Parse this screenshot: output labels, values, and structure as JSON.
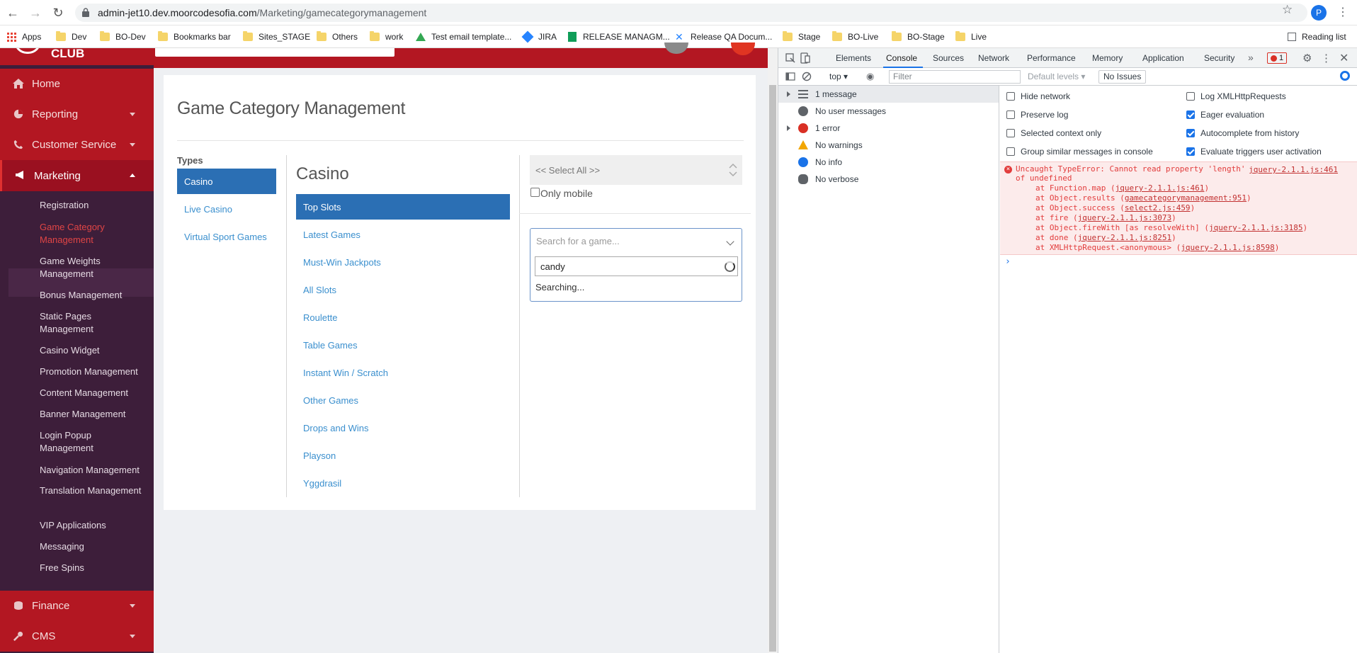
{
  "browser": {
    "url_host": "admin-jet10.dev.moorcodesofia.com",
    "url_path": "/Marketing/gamecategorymanagement",
    "profile_initial": "P",
    "bookmarks": [
      "Apps",
      "Dev",
      "BO-Dev",
      "Bookmarks bar",
      "Sites_STAGE",
      "Others",
      "work",
      "Test email template...",
      "JIRA",
      "RELEASE MANAGM...",
      "Release QA Docum...",
      "Stage",
      "BO-Live",
      "BO-Stage",
      "Live"
    ],
    "reading_list": "Reading list"
  },
  "header": {
    "logo_text": "CLUB"
  },
  "sidebar": {
    "main_items": [
      "Home",
      "Reporting",
      "Customer Service",
      "Marketing",
      "Finance",
      "CMS"
    ],
    "sub_items": [
      "Registration",
      "Game Category Management",
      "Game Weights Management",
      "Bonus Management",
      "Static Pages Management",
      "Casino Widget",
      "Promotion Management",
      "Content Management",
      "Banner Management",
      "Login Popup Management",
      "Navigation Management",
      "Translation Management",
      "VIP Applications",
      "Messaging",
      "Free Spins"
    ]
  },
  "page": {
    "title": "Game Category Management",
    "types_label": "Types",
    "types": [
      "Casino",
      "Live Casino",
      "Virtual Sport Games"
    ],
    "category_heading": "Casino",
    "categories": [
      "Top Slots",
      "Latest Games",
      "Must-Win Jackpots",
      "All Slots",
      "Roulette",
      "Table Games",
      "Instant Win / Scratch",
      "Other Games",
      "Drops and Wins",
      "Playson",
      "Yggdrasil"
    ],
    "select_all": "<< Select All >>",
    "only_mobile": "Only mobile",
    "search_placeholder": "Search for a game...",
    "search_query": "candy",
    "search_status": "Searching..."
  },
  "devtools": {
    "tabs": [
      "Elements",
      "Console",
      "Sources",
      "Network",
      "Performance",
      "Memory",
      "Application",
      "Security"
    ],
    "error_count": "1",
    "context": "top",
    "filter_placeholder": "Filter",
    "levels": "Default levels",
    "issues": "No Issues",
    "sidebar_items": [
      "1 message",
      "No user messages",
      "1 error",
      "No warnings",
      "No info",
      "No verbose"
    ],
    "options_left": [
      "Hide network",
      "Preserve log",
      "Selected context only",
      "Group similar messages in console"
    ],
    "options_right": [
      "Log XMLHttpRequests",
      "Eager evaluation",
      "Autocomplete from history",
      "Evaluate triggers user activation"
    ],
    "error": {
      "line1": "Uncaught TypeError: Cannot read property 'length'",
      "line2": "of undefined",
      "source": "jquery-2.1.1.js:461",
      "stack": [
        {
          "pre": "at Function.map (",
          "link": "jquery-2.1.1.js:461",
          "post": ")"
        },
        {
          "pre": "at Object.results (",
          "link": "gamecategorymanagement:951",
          "post": ")"
        },
        {
          "pre": "at Object.success (",
          "link": "select2.js:459",
          "post": ")"
        },
        {
          "pre": "at fire (",
          "link": "jquery-2.1.1.js:3073",
          "post": ")"
        },
        {
          "pre": "at Object.fireWith [as resolveWith] (",
          "link": "jquery-2.1.1.js:3185",
          "post": ")"
        },
        {
          "pre": "at done (",
          "link": "jquery-2.1.1.js:8251",
          "post": ")"
        },
        {
          "pre": "at XMLHttpRequest.<anonymous> (",
          "link": "jquery-2.1.1.js:8598",
          "post": ")"
        }
      ]
    }
  }
}
